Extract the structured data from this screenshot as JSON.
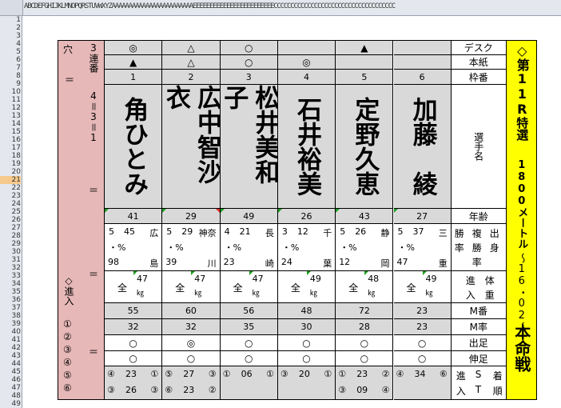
{
  "sheet": {
    "column_header_text": "ABCDEFGHIJKLMNOPQRSTUVWXYZAAAAAAAAAAAAAAAAAAAAAAAAEEEEEEEEEEEEEEEEEEEEEEEECCCCCCCCCCCCCCCCCCCCCCCCCCCCCCCCCCCC",
    "row_numbers": [
      "1",
      "2",
      "3",
      "4",
      "5",
      "6",
      "7",
      "8",
      "9",
      "10",
      "11",
      "12",
      "13",
      "14",
      "15",
      "16",
      "17",
      "18",
      "19",
      "20",
      "21",
      "22",
      "23",
      "24",
      "25",
      "26",
      "27",
      "28",
      "29",
      "30",
      "31",
      "32",
      "33",
      "34",
      "35",
      "36",
      "37",
      "38",
      "39",
      "40",
      "41",
      "42",
      "43",
      "44",
      "45",
      "46",
      "47",
      "48",
      "49"
    ],
    "selected_row": "21"
  },
  "left_panel": {
    "ana": "穴",
    "eq1": "＝",
    "sanrentan": "3連番",
    "formula": "4＝3＝1",
    "eq2": "＝",
    "eq3": "＝",
    "shinnyu": "◇進入",
    "circled": [
      "①",
      "②",
      "③",
      "④",
      "⑤",
      "⑥"
    ],
    "eq4": "＝"
  },
  "racers": [
    {
      "desk": "◎",
      "paper": "▲",
      "lane": "1",
      "name": "角ひとみ",
      "age": "41",
      "stat1": "5",
      "stat2": "45",
      "place1": "広",
      "pct": "・%",
      "num": "98",
      "place2": "島",
      "class": "全",
      "w1": "47",
      "w2": "㎏",
      "motor": "55",
      "mrate": "32",
      "start": "○",
      "nobi": "○",
      "st_a": "④",
      "st_b": "23",
      "st_c": "①",
      "st_d": "③",
      "st_e": "26",
      "st_f": "③"
    },
    {
      "desk": "△",
      "paper": "△",
      "lane": "2",
      "name": "広中智沙衣",
      "age": "29",
      "stat1": "5",
      "stat2": "29",
      "place1": "神奈",
      "pct": "・%",
      "num": "39",
      "place2": "川",
      "class": "全",
      "w1": "47",
      "w2": "㎏",
      "motor": "60",
      "mrate": "32",
      "start": "◎",
      "nobi": "○",
      "st_a": "⑤",
      "st_b": "27",
      "st_c": "③",
      "st_d": "⑥",
      "st_e": "23",
      "st_f": "②"
    },
    {
      "desk": "○",
      "paper": "○",
      "lane": "3",
      "name": "松井美和子",
      "age": "49",
      "stat1": "4",
      "stat2": "21",
      "place1": "長",
      "pct": "・%",
      "num": "23",
      "place2": "崎",
      "class": "全",
      "w1": "47",
      "w2": "㎏",
      "motor": "56",
      "mrate": "35",
      "start": "○",
      "nobi": "○",
      "st_a": "①",
      "st_b": "06",
      "st_c": "①",
      "st_d": "",
      "st_e": "",
      "st_f": ""
    },
    {
      "desk": "",
      "paper": "◎",
      "lane": "4",
      "name": "石井裕美",
      "age": "26",
      "stat1": "3",
      "stat2": "12",
      "place1": "千",
      "pct": "・%",
      "num": "24",
      "place2": "葉",
      "class": "全",
      "w1": "49",
      "w2": "㎏",
      "motor": "48",
      "mrate": "30",
      "start": "○",
      "nobi": "○",
      "st_a": "③",
      "st_b": "20",
      "st_c": "①",
      "st_d": "",
      "st_e": "",
      "st_f": ""
    },
    {
      "desk": "▲",
      "paper": "",
      "lane": "5",
      "name": "定野久恵",
      "age": "43",
      "stat1": "5",
      "stat2": "26",
      "place1": "静",
      "pct": "・%",
      "num": "12",
      "place2": "岡",
      "class": "全",
      "w1": "48",
      "w2": "㎏",
      "motor": "72",
      "mrate": "28",
      "start": "○",
      "nobi": "○",
      "st_a": "①",
      "st_b": "23",
      "st_c": "②",
      "st_d": "③",
      "st_e": "09",
      "st_f": "④"
    },
    {
      "desk": "",
      "paper": "",
      "lane": "6",
      "name": "加藤　綾",
      "age": "27",
      "stat1": "5",
      "stat2": "37",
      "place1": "三",
      "pct": "・%",
      "num": "47",
      "place2": "重",
      "class": "全",
      "w1": "49",
      "w2": "㎏",
      "motor": "23",
      "mrate": "23",
      "start": "○",
      "nobi": "○",
      "st_a": "④",
      "st_b": "34",
      "st_c": "⑥",
      "st_d": "",
      "st_e": "",
      "st_f": ""
    }
  ],
  "labels": {
    "desk": "デスク",
    "paper": "本紙",
    "lane": "枠番",
    "name": "選手名",
    "age": "年齢",
    "stats1": "勝",
    "stats2": "複",
    "stats3": "出",
    "stats4": "率",
    "stats5": "勝",
    "stats6": "身",
    "stats7": "率",
    "shinnyu1": "進",
    "shinnyu2": "体",
    "shinnyu3": "入",
    "shinnyu4": "重",
    "motor": "M番",
    "mrate": "M率",
    "start": "出足",
    "nobi": "伸足",
    "last1": "進",
    "last2": "S",
    "last3": "着",
    "last4": "入",
    "last5": "T",
    "last6": "順"
  },
  "right_panel": {
    "title1": "◇第11R",
    "title2": "特選",
    "distance": "1800メートル",
    "time": "～16・02～",
    "race": "本命戦"
  }
}
